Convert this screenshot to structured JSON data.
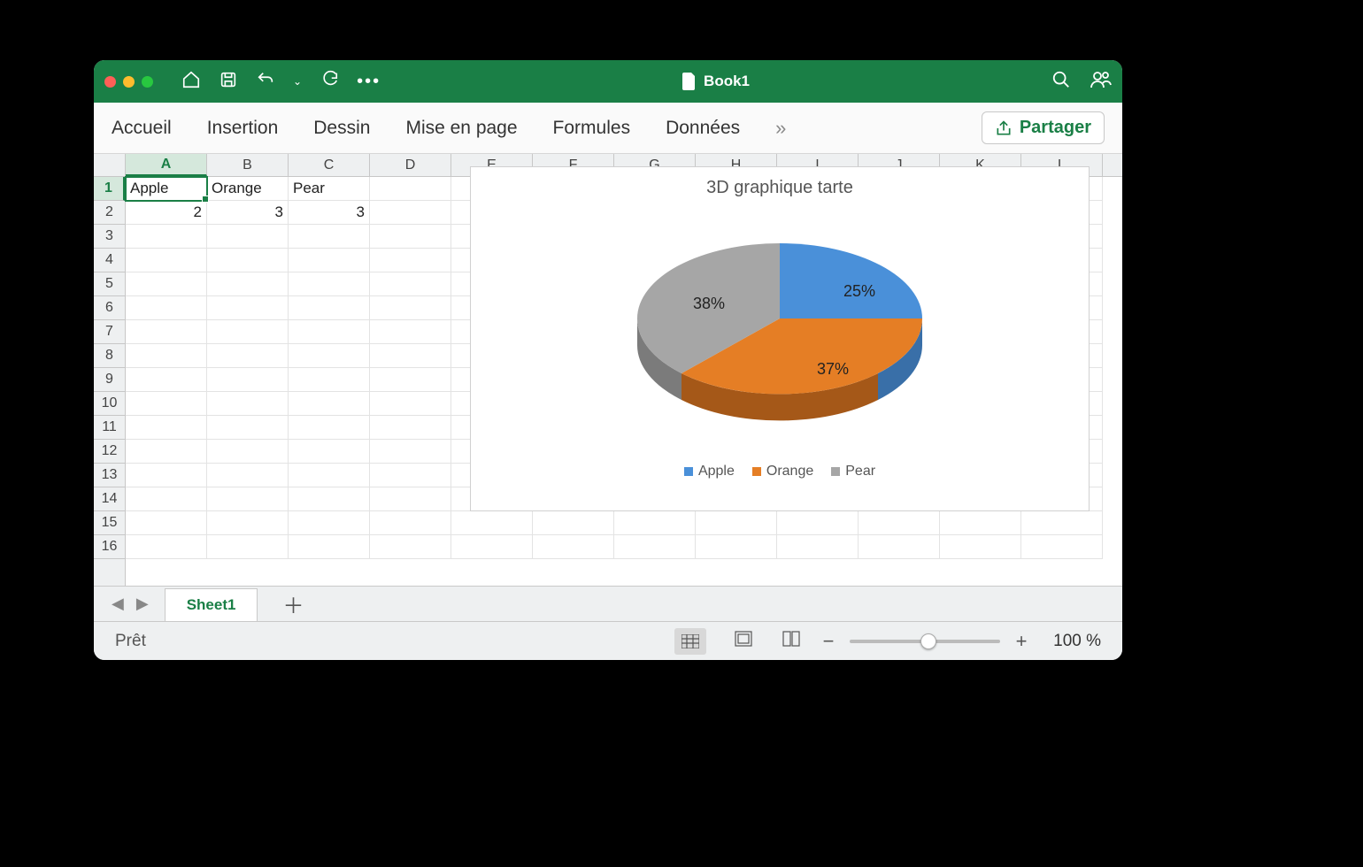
{
  "window": {
    "title": "Book1"
  },
  "colors": {
    "accent": "#1a7f46",
    "traffic": {
      "close": "#ff5f57",
      "min": "#febc2e",
      "max": "#28c840"
    },
    "pie": {
      "apple": "#4a90d9",
      "apple_dark": "#396fa8",
      "orange": "#e57e25",
      "orange_dark": "#a55818",
      "pear": "#a6a6a6",
      "pear_dark": "#7b7b7b"
    }
  },
  "ribbon": {
    "tabs": [
      "Accueil",
      "Insertion",
      "Dessin",
      "Mise en page",
      "Formules",
      "Données"
    ],
    "more": "»",
    "share_label": "Partager"
  },
  "columns": [
    "A",
    "B",
    "C",
    "D",
    "E",
    "F",
    "G",
    "H",
    "I",
    "J",
    "K",
    "L"
  ],
  "rows": [
    1,
    2,
    3,
    4,
    5,
    6,
    7,
    8,
    9,
    10,
    11,
    12,
    13,
    14,
    15,
    16
  ],
  "active_cell": "A1",
  "cells": {
    "A1": "Apple",
    "B1": "Orange",
    "C1": "Pear",
    "A2": "2",
    "B2": "3",
    "C2": "3"
  },
  "chart_data": {
    "type": "pie",
    "title": "3D graphique tarte",
    "series": [
      {
        "name": "Apple",
        "value": 2,
        "percent": "25%"
      },
      {
        "name": "Orange",
        "value": 3,
        "percent": "37%"
      },
      {
        "name": "Pear",
        "value": 3,
        "percent": "38%"
      }
    ]
  },
  "sheets": {
    "active": "Sheet1"
  },
  "status": {
    "text": "Prêt",
    "zoom": "100 %"
  }
}
